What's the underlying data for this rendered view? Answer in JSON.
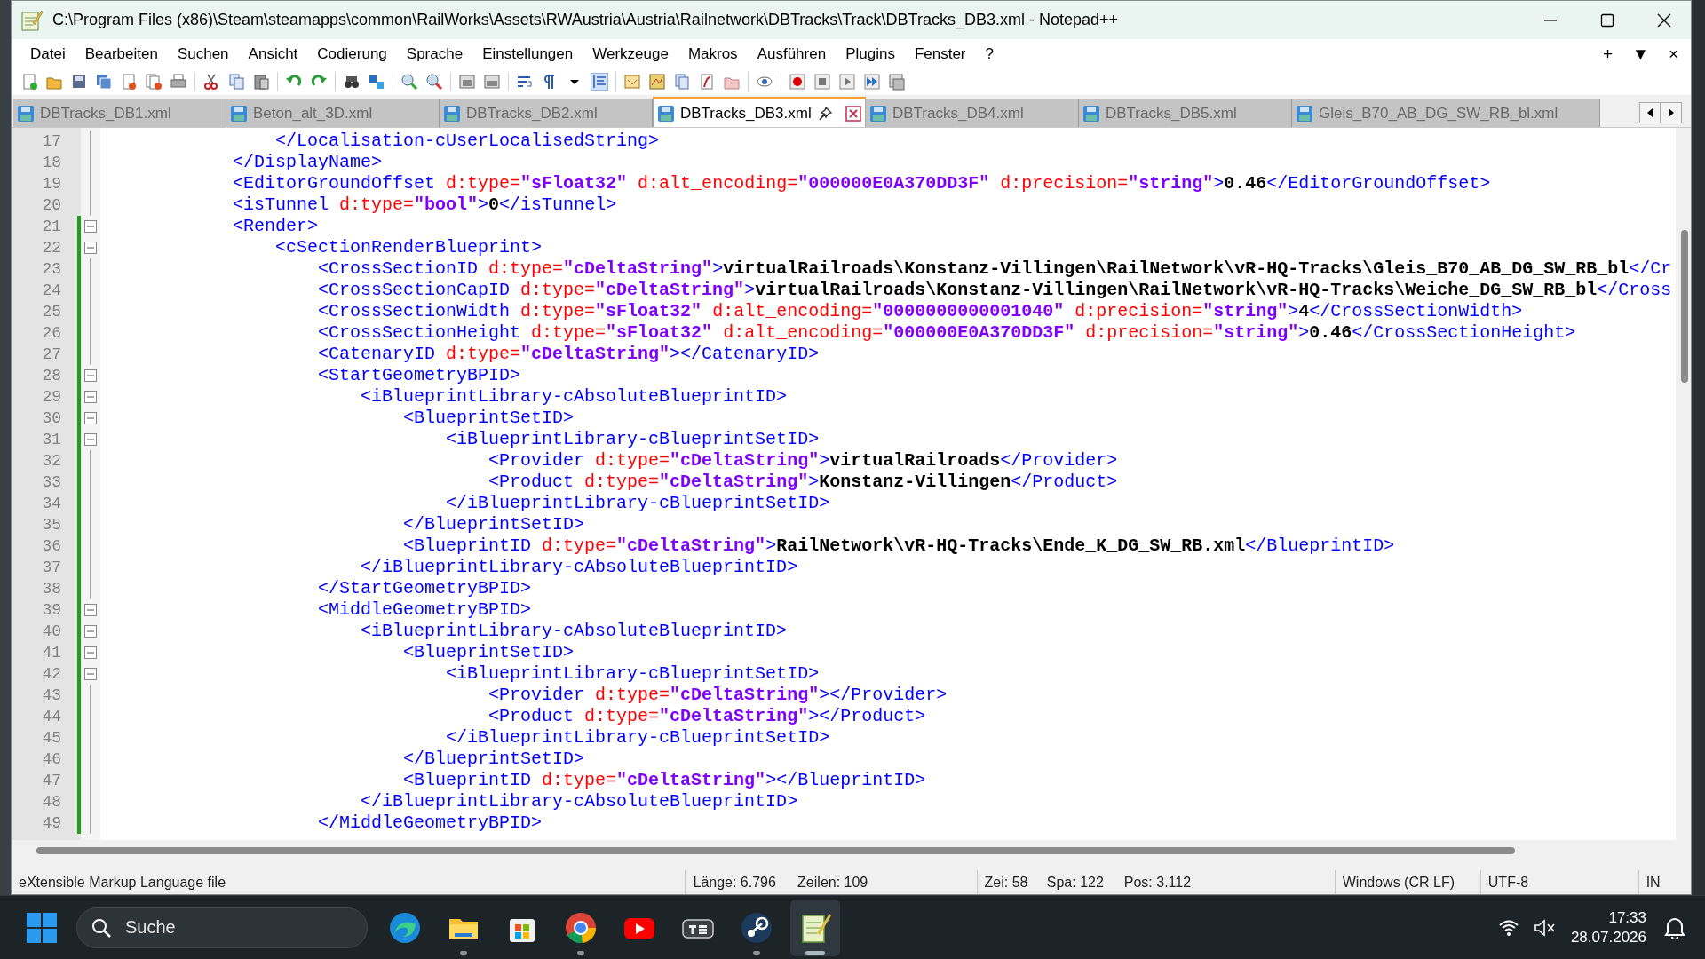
{
  "window": {
    "title": "C:\\Program Files (x86)\\Steam\\steamapps\\common\\RailWorks\\Assets\\RWAustria\\Austria\\Railnetwork\\DBTracks\\Track\\DBTracks_DB3.xml - Notepad++"
  },
  "menu": [
    "Datei",
    "Bearbeiten",
    "Suchen",
    "Ansicht",
    "Codierung",
    "Sprache",
    "Einstellungen",
    "Werkzeuge",
    "Makros",
    "Ausführen",
    "Plugins",
    "Fenster",
    "?"
  ],
  "menu_right": [
    "+",
    "▼",
    "×"
  ],
  "tabs": [
    {
      "label": "DBTracks_DB1.xml",
      "selected": false
    },
    {
      "label": "Beton_alt_3D.xml",
      "selected": false
    },
    {
      "label": "DBTracks_DB2.xml",
      "selected": false
    },
    {
      "label": "DBTracks_DB3.xml",
      "selected": true
    },
    {
      "label": "DBTracks_DB4.xml",
      "selected": false
    },
    {
      "label": "DBTracks_DB5.xml",
      "selected": false
    },
    {
      "label": "Gleis_B70_AB_DG_SW_RB_bl.xml",
      "selected": false
    }
  ],
  "lines": [
    {
      "number": "17",
      "fold_header": false,
      "changed": false,
      "tokens": [
        {
          "kind": "tag",
          "text": "                </Localisation-cUserLocalisedString>"
        }
      ]
    },
    {
      "number": "18",
      "fold_header": false,
      "changed": false,
      "tokens": [
        {
          "kind": "tag",
          "text": "            </DisplayName>"
        }
      ]
    },
    {
      "number": "19",
      "fold_header": false,
      "changed": false,
      "tokens": [
        {
          "kind": "tag",
          "text": "            <EditorGroundOffset"
        },
        {
          "kind": "attr",
          "text": " d:type="
        },
        {
          "kind": "value",
          "text": "\"sFloat32\""
        },
        {
          "kind": "attr",
          "text": " d:alt_encoding="
        },
        {
          "kind": "value",
          "text": "\"000000E0A370DD3F\""
        },
        {
          "kind": "attr",
          "text": " d:precision="
        },
        {
          "kind": "value",
          "text": "\"string\""
        },
        {
          "kind": "tag",
          "text": ">"
        },
        {
          "kind": "text",
          "text": "0.46"
        },
        {
          "kind": "tag",
          "text": "</EditorGroundOffset>"
        }
      ]
    },
    {
      "number": "20",
      "fold_header": false,
      "changed": false,
      "tokens": [
        {
          "kind": "tag",
          "text": "            <isTunnel"
        },
        {
          "kind": "attr",
          "text": " d:type="
        },
        {
          "kind": "value",
          "text": "\"bool\""
        },
        {
          "kind": "tag",
          "text": ">"
        },
        {
          "kind": "text",
          "text": "0"
        },
        {
          "kind": "tag",
          "text": "</isTunnel>"
        }
      ]
    },
    {
      "number": "21",
      "fold_header": true,
      "changed": true,
      "tokens": [
        {
          "kind": "tag",
          "text": "            <Render>"
        }
      ]
    },
    {
      "number": "22",
      "fold_header": true,
      "changed": true,
      "tokens": [
        {
          "kind": "tag",
          "text": "                <cSectionRenderBlueprint>"
        }
      ]
    },
    {
      "number": "23",
      "fold_header": false,
      "changed": true,
      "tokens": [
        {
          "kind": "tag",
          "text": "                    <CrossSectionID"
        },
        {
          "kind": "attr",
          "text": " d:type="
        },
        {
          "kind": "value",
          "text": "\"cDeltaString\""
        },
        {
          "kind": "tag",
          "text": ">"
        },
        {
          "kind": "text",
          "text": "virtualRailroads\\Konstanz-Villingen\\RailNetwork\\vR-HQ-Tracks\\Gleis_B70_AB_DG_SW_RB_bl"
        },
        {
          "kind": "tag",
          "text": "</Cr"
        }
      ]
    },
    {
      "number": "24",
      "fold_header": false,
      "changed": true,
      "tokens": [
        {
          "kind": "tag",
          "text": "                    <CrossSectionCapID"
        },
        {
          "kind": "attr",
          "text": " d:type="
        },
        {
          "kind": "value",
          "text": "\"cDeltaString\""
        },
        {
          "kind": "tag",
          "text": ">"
        },
        {
          "kind": "text",
          "text": "virtualRailroads\\Konstanz-Villingen\\RailNetwork\\vR-HQ-Tracks\\Weiche_DG_SW_RB_bl"
        },
        {
          "kind": "tag",
          "text": "</Cross"
        }
      ]
    },
    {
      "number": "25",
      "fold_header": false,
      "changed": true,
      "tokens": [
        {
          "kind": "tag",
          "text": "                    <CrossSectionWidth"
        },
        {
          "kind": "attr",
          "text": " d:type="
        },
        {
          "kind": "value",
          "text": "\"sFloat32\""
        },
        {
          "kind": "attr",
          "text": " d:alt_encoding="
        },
        {
          "kind": "value",
          "text": "\"0000000000001040\""
        },
        {
          "kind": "attr",
          "text": " d:precision="
        },
        {
          "kind": "value",
          "text": "\"string\""
        },
        {
          "kind": "tag",
          "text": ">"
        },
        {
          "kind": "text",
          "text": "4"
        },
        {
          "kind": "tag",
          "text": "</CrossSectionWidth>"
        }
      ]
    },
    {
      "number": "26",
      "fold_header": false,
      "changed": true,
      "tokens": [
        {
          "kind": "tag",
          "text": "                    <CrossSectionHeight"
        },
        {
          "kind": "attr",
          "text": " d:type="
        },
        {
          "kind": "value",
          "text": "\"sFloat32\""
        },
        {
          "kind": "attr",
          "text": " d:alt_encoding="
        },
        {
          "kind": "value",
          "text": "\"000000E0A370DD3F\""
        },
        {
          "kind": "attr",
          "text": " d:precision="
        },
        {
          "kind": "value",
          "text": "\"string\""
        },
        {
          "kind": "tag",
          "text": ">"
        },
        {
          "kind": "text",
          "text": "0.46"
        },
        {
          "kind": "tag",
          "text": "</CrossSectionHeight>"
        }
      ]
    },
    {
      "number": "27",
      "fold_header": false,
      "changed": true,
      "tokens": [
        {
          "kind": "tag",
          "text": "                    <CatenaryID"
        },
        {
          "kind": "attr",
          "text": " d:type="
        },
        {
          "kind": "value",
          "text": "\"cDeltaString\""
        },
        {
          "kind": "tag",
          "text": "></CatenaryID>"
        }
      ]
    },
    {
      "number": "28",
      "fold_header": true,
      "changed": true,
      "tokens": [
        {
          "kind": "tag",
          "text": "                    <StartGeometryBPID>"
        }
      ]
    },
    {
      "number": "29",
      "fold_header": true,
      "changed": true,
      "tokens": [
        {
          "kind": "tag",
          "text": "                        <iBlueprintLibrary-cAbsoluteBlueprintID>"
        }
      ]
    },
    {
      "number": "30",
      "fold_header": true,
      "changed": true,
      "tokens": [
        {
          "kind": "tag",
          "text": "                            <BlueprintSetID>"
        }
      ]
    },
    {
      "number": "31",
      "fold_header": true,
      "changed": true,
      "tokens": [
        {
          "kind": "tag",
          "text": "                                <iBlueprintLibrary-cBlueprintSetID>"
        }
      ]
    },
    {
      "number": "32",
      "fold_header": false,
      "changed": true,
      "tokens": [
        {
          "kind": "tag",
          "text": "                                    <Provider"
        },
        {
          "kind": "attr",
          "text": " d:type="
        },
        {
          "kind": "value",
          "text": "\"cDeltaString\""
        },
        {
          "kind": "tag",
          "text": ">"
        },
        {
          "kind": "text",
          "text": "virtualRailroads"
        },
        {
          "kind": "tag",
          "text": "</Provider>"
        }
      ]
    },
    {
      "number": "33",
      "fold_header": false,
      "changed": true,
      "tokens": [
        {
          "kind": "tag",
          "text": "                                    <Product"
        },
        {
          "kind": "attr",
          "text": " d:type="
        },
        {
          "kind": "value",
          "text": "\"cDeltaString\""
        },
        {
          "kind": "tag",
          "text": ">"
        },
        {
          "kind": "text",
          "text": "Konstanz-Villingen"
        },
        {
          "kind": "tag",
          "text": "</Product>"
        }
      ]
    },
    {
      "number": "34",
      "fold_header": false,
      "changed": true,
      "tokens": [
        {
          "kind": "tag",
          "text": "                                </iBlueprintLibrary-cBlueprintSetID>"
        }
      ]
    },
    {
      "number": "35",
      "fold_header": false,
      "changed": true,
      "tokens": [
        {
          "kind": "tag",
          "text": "                            </BlueprintSetID>"
        }
      ]
    },
    {
      "number": "36",
      "fold_header": false,
      "changed": true,
      "tokens": [
        {
          "kind": "tag",
          "text": "                            <BlueprintID"
        },
        {
          "kind": "attr",
          "text": " d:type="
        },
        {
          "kind": "value",
          "text": "\"cDeltaString\""
        },
        {
          "kind": "tag",
          "text": ">"
        },
        {
          "kind": "text",
          "text": "RailNetwork\\vR-HQ-Tracks\\Ende_K_DG_SW_RB.xml"
        },
        {
          "kind": "tag",
          "text": "</BlueprintID>"
        }
      ]
    },
    {
      "number": "37",
      "fold_header": false,
      "changed": true,
      "tokens": [
        {
          "kind": "tag",
          "text": "                        </iBlueprintLibrary-cAbsoluteBlueprintID>"
        }
      ]
    },
    {
      "number": "38",
      "fold_header": false,
      "changed": true,
      "tokens": [
        {
          "kind": "tag",
          "text": "                    </StartGeometryBPID>"
        }
      ]
    },
    {
      "number": "39",
      "fold_header": true,
      "changed": true,
      "tokens": [
        {
          "kind": "tag",
          "text": "                    <MiddleGeometryBPID>"
        }
      ]
    },
    {
      "number": "40",
      "fold_header": true,
      "changed": true,
      "tokens": [
        {
          "kind": "tag",
          "text": "                        <iBlueprintLibrary-cAbsoluteBlueprintID>"
        }
      ]
    },
    {
      "number": "41",
      "fold_header": true,
      "changed": true,
      "tokens": [
        {
          "kind": "tag",
          "text": "                            <BlueprintSetID>"
        }
      ]
    },
    {
      "number": "42",
      "fold_header": true,
      "changed": true,
      "tokens": [
        {
          "kind": "tag",
          "text": "                                <iBlueprintLibrary-cBlueprintSetID>"
        }
      ]
    },
    {
      "number": "43",
      "fold_header": false,
      "changed": true,
      "tokens": [
        {
          "kind": "tag",
          "text": "                                    <Provider"
        },
        {
          "kind": "attr",
          "text": " d:type="
        },
        {
          "kind": "value",
          "text": "\"cDeltaString\""
        },
        {
          "kind": "tag",
          "text": "></Provider>"
        }
      ]
    },
    {
      "number": "44",
      "fold_header": false,
      "changed": true,
      "tokens": [
        {
          "kind": "tag",
          "text": "                                    <Product"
        },
        {
          "kind": "attr",
          "text": " d:type="
        },
        {
          "kind": "value",
          "text": "\"cDeltaString\""
        },
        {
          "kind": "tag",
          "text": "></Product>"
        }
      ]
    },
    {
      "number": "45",
      "fold_header": false,
      "changed": true,
      "tokens": [
        {
          "kind": "tag",
          "text": "                                </iBlueprintLibrary-cBlueprintSetID>"
        }
      ]
    },
    {
      "number": "46",
      "fold_header": false,
      "changed": true,
      "tokens": [
        {
          "kind": "tag",
          "text": "                            </BlueprintSetID>"
        }
      ]
    },
    {
      "number": "47",
      "fold_header": false,
      "changed": true,
      "tokens": [
        {
          "kind": "tag",
          "text": "                            <BlueprintID"
        },
        {
          "kind": "attr",
          "text": " d:type="
        },
        {
          "kind": "value",
          "text": "\"cDeltaString\""
        },
        {
          "kind": "tag",
          "text": "></BlueprintID>"
        }
      ]
    },
    {
      "number": "48",
      "fold_header": false,
      "changed": true,
      "tokens": [
        {
          "kind": "tag",
          "text": "                        </iBlueprintLibrary-cAbsoluteBlueprintID>"
        }
      ]
    },
    {
      "number": "49",
      "fold_header": false,
      "changed": true,
      "tokens": [
        {
          "kind": "tag",
          "text": "                    </MiddleGeometryBPID>"
        }
      ]
    }
  ],
  "status_bar": [
    "eXtensible Markup Language file",
    "Länge: 6.796",
    "Zeilen: 109",
    "Zei: 58",
    "Spa: 122",
    "Pos: 3.112",
    "Windows (CR LF)",
    "UTF-8",
    "IN"
  ],
  "taskbar": {
    "search": {
      "placeholder": "Suche"
    },
    "apps": [
      {
        "kind": "edge",
        "open": false,
        "active": false
      },
      {
        "kind": "explorer",
        "open": true,
        "active": false
      },
      {
        "kind": "store",
        "open": false,
        "active": false
      },
      {
        "kind": "chrome",
        "open": true,
        "active": false
      },
      {
        "kind": "youtube",
        "open": false,
        "active": false
      },
      {
        "kind": "ts",
        "open": false,
        "active": false
      },
      {
        "kind": "steam",
        "open": true,
        "active": false
      },
      {
        "kind": "notepad",
        "open": true,
        "active": true
      }
    ],
    "time": "17:33",
    "date": "28.07.2026"
  }
}
